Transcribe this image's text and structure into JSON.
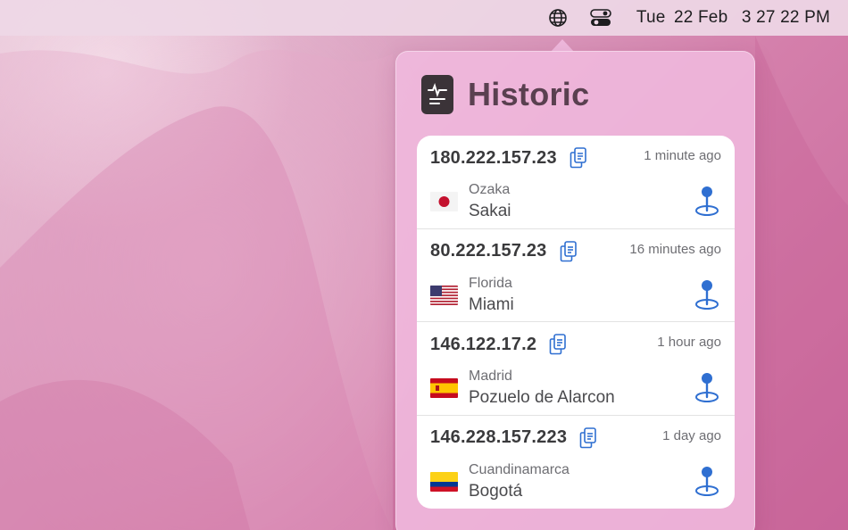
{
  "menubar": {
    "icons": [
      "globe-icon",
      "control-center-icon"
    ],
    "clock": {
      "day": "Tue",
      "date": "22 Feb",
      "time": "3 27 22 PM"
    }
  },
  "popover": {
    "title": "Historic",
    "entries": [
      {
        "ip": "180.222.157.23",
        "time": "1 minute ago",
        "region": "Ozaka",
        "city": "Sakai",
        "flag": "japan-flag"
      },
      {
        "ip": "80.222.157.23",
        "time": "16 minutes ago",
        "region": "Florida",
        "city": "Miami",
        "flag": "usa-flag"
      },
      {
        "ip": "146.122.17.2",
        "time": "1 hour ago",
        "region": "Madrid",
        "city": "Pozuelo de Alarcon",
        "flag": "spain-flag"
      },
      {
        "ip": "146.228.157.223",
        "time": "1 day ago",
        "region": "Cuandinamarca",
        "city": "Bogotá",
        "flag": "colombia-flag"
      }
    ]
  },
  "colors": {
    "accent_blue": "#2f6fd1",
    "title": "#5a4050",
    "popover_bg": "#f0bade"
  }
}
